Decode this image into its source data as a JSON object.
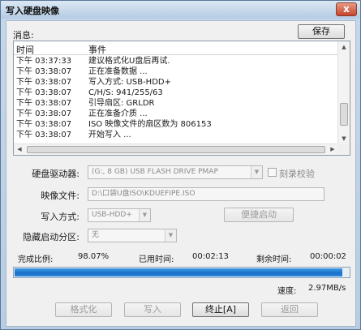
{
  "window": {
    "title": "写入硬盘映像",
    "close_glyph": "x"
  },
  "messages": {
    "label": "消息:",
    "save_button": "保存",
    "columns": [
      "时间",
      "事件"
    ],
    "rows": [
      {
        "time": "下午 03:37:33",
        "event": "建议格式化U盘后再试."
      },
      {
        "time": "下午 03:38:07",
        "event": "正在准备数据 ..."
      },
      {
        "time": "下午 03:38:07",
        "event": "写入方式: USB-HDD+"
      },
      {
        "time": "下午 03:38:07",
        "event": "C/H/S: 941/255/63"
      },
      {
        "time": "下午 03:38:07",
        "event": "引导扇区: GRLDR"
      },
      {
        "time": "下午 03:38:07",
        "event": "正在准备介质 ..."
      },
      {
        "time": "下午 03:38:07",
        "event": "ISO 映像文件的扇区数为 806153"
      },
      {
        "time": "下午 03:38:07",
        "event": "开始写入 ..."
      }
    ]
  },
  "form": {
    "drive_label": "硬盘驱动器:",
    "drive_value": "(G:, 8 GB)          USB FLASH DRIVE PMAP",
    "verify_label": "刻录校验",
    "image_label": "映像文件:",
    "image_value": "D:\\口袋U盘ISO\\KDUEFIPE.ISO",
    "write_mode_label": "写入方式:",
    "write_mode_value": "USB-HDD+",
    "quick_boot_button": "便捷启动",
    "hidden_partition_label": "隐藏启动分区:",
    "hidden_partition_value": "无"
  },
  "status": {
    "completion_label": "完成比例:",
    "completion_value": "98.07%",
    "completion_fraction": 0.9807,
    "elapsed_label": "已用时间:",
    "elapsed_value": "00:02:13",
    "remaining_label": "剩余时间:",
    "remaining_value": "00:00:02",
    "speed_label": "速度:",
    "speed_value": "2.97MB/s"
  },
  "buttons": {
    "format": "格式化",
    "write": "写入",
    "abort": "终止[A]",
    "back": "返回"
  }
}
